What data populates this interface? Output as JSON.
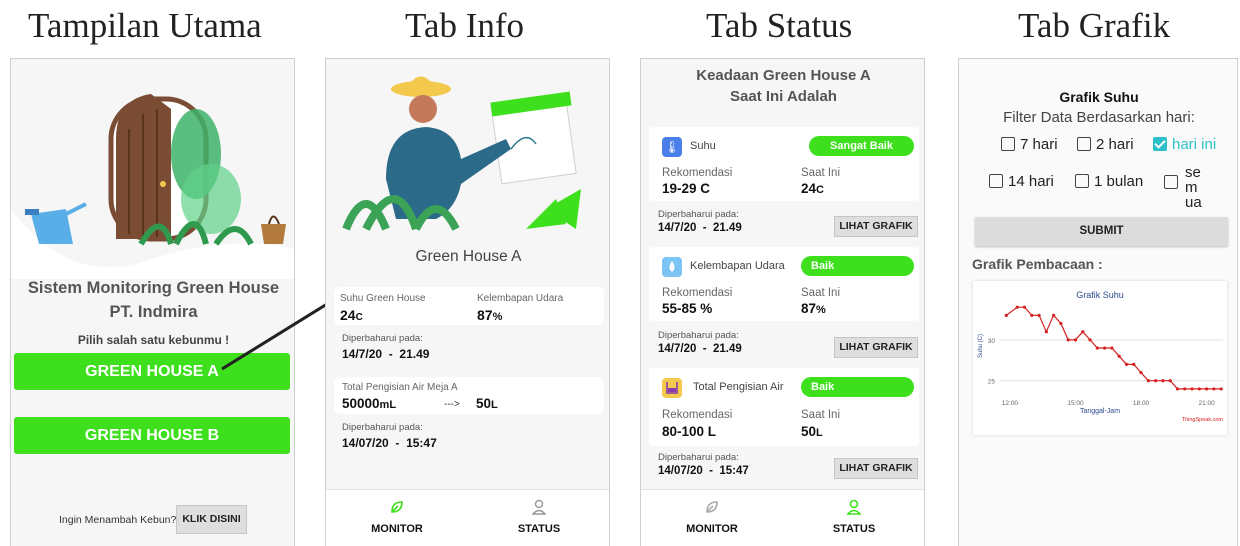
{
  "headings": {
    "main": "Tampilan Utama",
    "info": "Tab Info",
    "status": "Tab Status",
    "grafik": "Tab Grafik"
  },
  "main_screen": {
    "title_line1": "Sistem Monitoring Green House",
    "title_line2": "PT. Indmira",
    "prompt": "Pilih salah satu kebunmu !",
    "button_a": "GREEN HOUSE A",
    "button_b": "GREEN HOUSE B",
    "add_prompt": "Ingin Menambah Kebun?",
    "add_button": "KLIK DISINI"
  },
  "info_screen": {
    "greenhouse_name": "Green House A",
    "card1": {
      "suhu_label": "Suhu Green House",
      "suhu_value": "24",
      "suhu_unit": "C",
      "kelembapan_label": "Kelembapan Udara",
      "kelembapan_value": "87",
      "kelembapan_unit": "%",
      "updated_label": "Diperbaharui pada:",
      "updated_date": "14/7/20",
      "updated_sep": "-",
      "updated_time": "21.49"
    },
    "card2": {
      "air_label": "Total Pengisian Air Meja A",
      "air_value": "50000",
      "air_unit": "mL",
      "arrow": "--->",
      "air_value2": "50",
      "air_unit2": "L",
      "updated_label": "Diperbaharui pada:",
      "updated_date": "14/07/20",
      "updated_sep": "-",
      "updated_time": "15:47"
    },
    "nav": {
      "monitor": "MONITOR",
      "status": "STATUS"
    }
  },
  "status_screen": {
    "title_line1": "Keadaan Green House A",
    "title_line2": "Saat Ini Adalah",
    "rows": [
      {
        "name": "Suhu",
        "badge": "Sangat Baik",
        "icon": "thermometer-icon",
        "icon_color": "#4a7ee8",
        "rek_label": "Rekomendasi",
        "rek_value": "19-29 C",
        "now_label": "Saat Ini",
        "now_value": "24",
        "now_unit": "C",
        "updated_label": "Diperbaharui pada:",
        "updated_value": "14/7/20  -  21.49",
        "button": "LIHAT GRAFIK"
      },
      {
        "name": "Kelembapan Udara",
        "badge": "Baik",
        "icon": "droplet-icon",
        "icon_color": "#7cc4f4",
        "rek_label": "Rekomendasi",
        "rek_value": "55-85 %",
        "now_label": "Saat Ini",
        "now_value": "87",
        "now_unit": "%",
        "updated_label": "Diperbaharui pada:",
        "updated_value": "14/7/20  -  21.49",
        "button": "LIHAT GRAFIK"
      },
      {
        "name": "Total Pengisian Air",
        "badge": "Baik",
        "icon": "water-tank-icon",
        "icon_color": "#f2c94c",
        "rek_label": "Rekomendasi",
        "rek_value": "80-100 L",
        "now_label": "Saat Ini",
        "now_value": "50",
        "now_unit": "L",
        "updated_label": "Diperbaharui pada:",
        "updated_value": "14/07/20  -  15:47",
        "button": "LIHAT GRAFIK"
      }
    ],
    "trailing_dash": "-",
    "nav": {
      "monitor": "MONITOR",
      "status": "STATUS"
    }
  },
  "grafik_screen": {
    "title": "Grafik Suhu",
    "filter_label": "Filter Data Berdasarkan hari:",
    "options": [
      "7 hari",
      "2 hari",
      "hari ini",
      "14 hari",
      "1 bulan",
      "semua"
    ],
    "selected": "hari ini",
    "submit": "SUBMIT",
    "reading_label": "Grafik Pembacaan :"
  },
  "colors": {
    "accent_green": "#3ee01e",
    "checkbox_teal": "#2bc0c8",
    "chart_red": "#d42020",
    "chart_title_blue": "#2c4a8c"
  },
  "chart_data": {
    "type": "line",
    "title": "Grafik Suhu",
    "xlabel": "Tanggal-Jam",
    "ylabel": "Suhu (C)",
    "x_ticks": [
      "12:00",
      "15:00",
      "18:00",
      "21:00"
    ],
    "y_ticks": [
      25,
      30
    ],
    "xlim": [
      "11:30",
      "21:45"
    ],
    "ylim": [
      23.5,
      35
    ],
    "watermark": "ThingSpeak.com",
    "series": [
      {
        "x": [
          "11:50",
          "12:20",
          "12:40",
          "13:00",
          "13:20",
          "13:40",
          "14:00",
          "14:20",
          "14:40",
          "15:00",
          "15:20",
          "15:40",
          "16:00",
          "16:20",
          "16:40",
          "17:00",
          "17:20",
          "17:40",
          "18:00",
          "18:20",
          "18:40",
          "19:00",
          "19:20",
          "19:40",
          "20:00",
          "20:20",
          "20:40",
          "21:00",
          "21:20",
          "21:40"
        ],
        "y": [
          33,
          34,
          34,
          33,
          33,
          31,
          33,
          32,
          30,
          30,
          31,
          30,
          29,
          29,
          29,
          28,
          27,
          27,
          26,
          25,
          25,
          25,
          25,
          24,
          24,
          24,
          24,
          24,
          24,
          24
        ]
      }
    ]
  }
}
